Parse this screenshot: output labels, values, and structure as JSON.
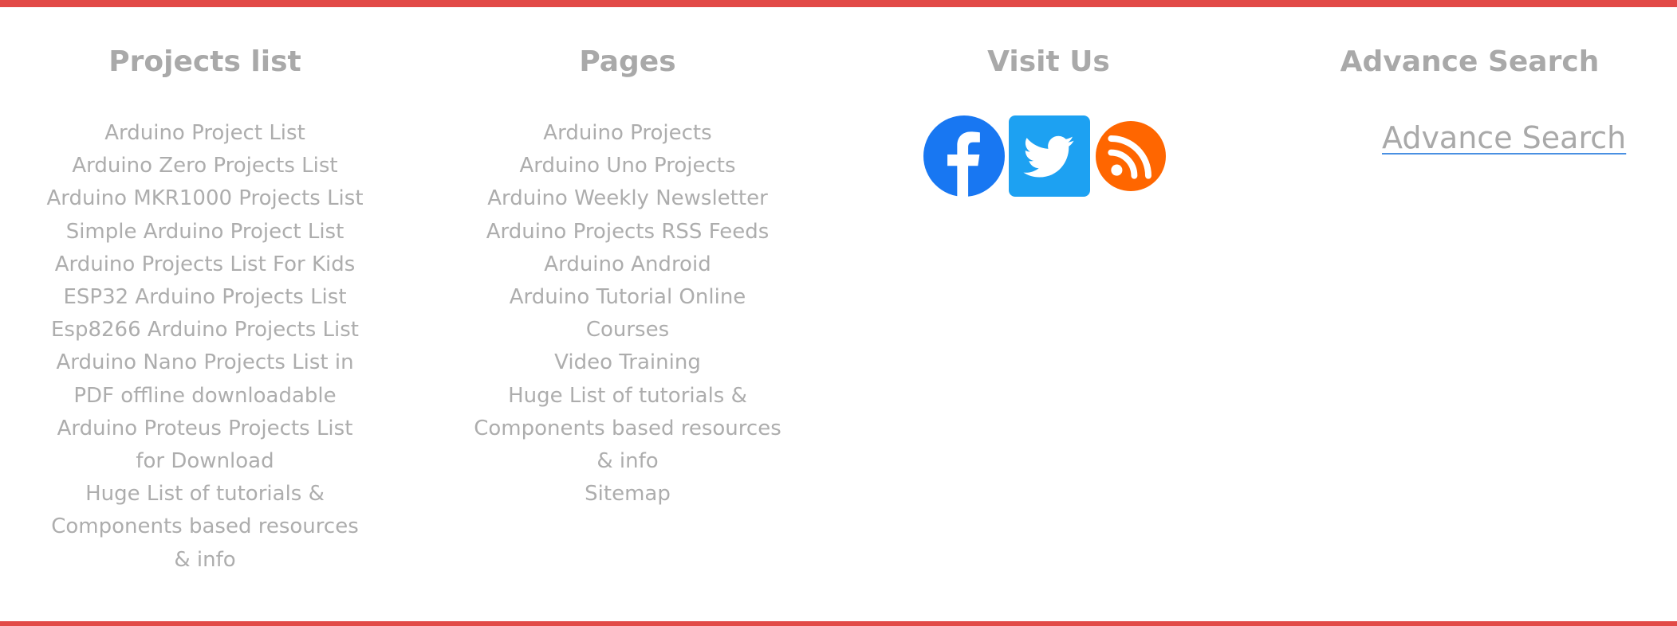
{
  "colors": {
    "accent_border": "#e24a47",
    "heading_text": "#a9a9a9",
    "link_text": "#adadad",
    "facebook": "#1877f2",
    "twitter": "#1da1f2",
    "rss": "#ff6600",
    "search_underline": "#4a90e2"
  },
  "footer": {
    "projects": {
      "title": "Projects list",
      "items": [
        "Arduino Project List",
        "Arduino Zero Projects List",
        "Arduino MKR1000 Projects List",
        "Simple Arduino Project List",
        "Arduino Projects List For Kids",
        "ESP32 Arduino Projects List",
        "Esp8266 Arduino Projects List",
        "Arduino Nano Projects List in PDF offline downloadable",
        "Arduino Proteus Projects List for Download",
        "Huge List of tutorials & Components based resources & info"
      ]
    },
    "pages": {
      "title": "Pages",
      "items": [
        "Arduino Projects",
        "Arduino Uno Projects",
        "Arduino Weekly Newsletter",
        "Arduino Projects RSS Feeds",
        "Arduino Android",
        "Arduino Tutorial Online Courses",
        "Video Training",
        "Huge List of tutorials & Components based resources & info",
        "Sitemap"
      ]
    },
    "visit": {
      "title": "Visit Us",
      "icons": [
        "facebook-icon",
        "twitter-icon",
        "rss-icon"
      ]
    },
    "search": {
      "title": "Advance Search",
      "link": "Advance Search"
    }
  }
}
